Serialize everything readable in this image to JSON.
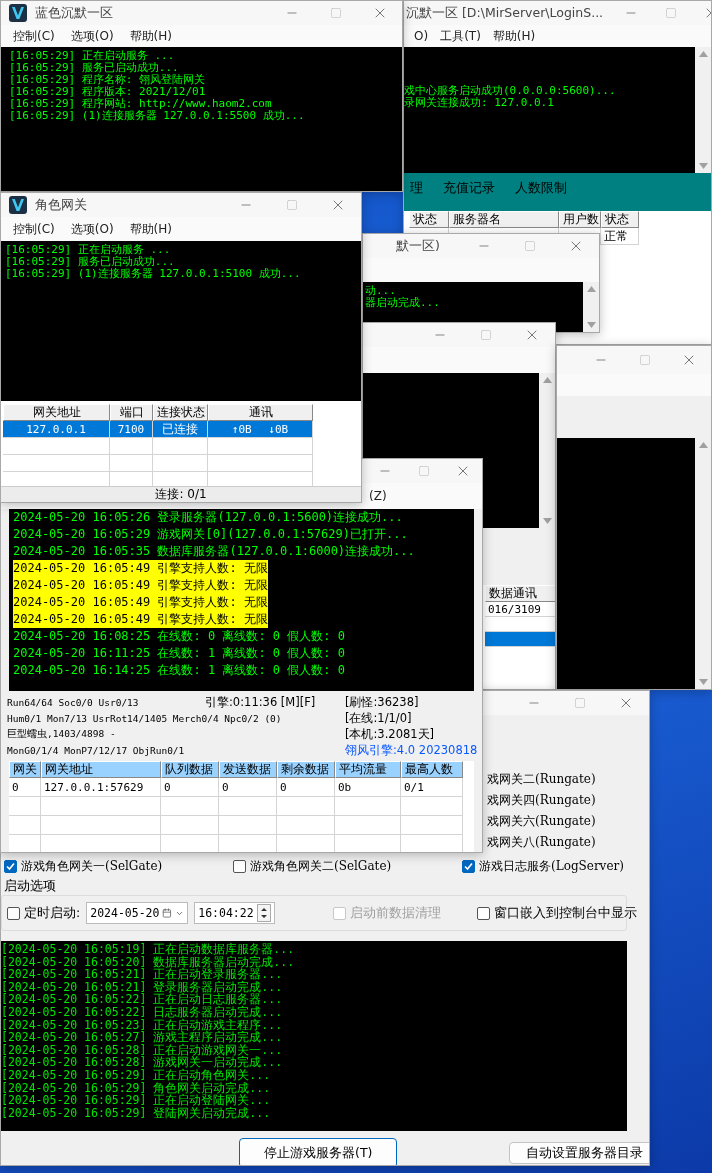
{
  "login_server_window": {
    "title": "沉默一区  [D:\\MirServer\\LoginS...",
    "menu": [
      "O)",
      "工具(T)",
      "帮助(H)"
    ],
    "log": [
      "戏中心服务启动成功(0.0.0.0:5600)...",
      "录网关连接成功: 127.0.0.1"
    ],
    "tabs": [
      "理",
      "充值记录",
      "人数限制"
    ],
    "columns": [
      "状态",
      "服务器名",
      "用户数",
      "状态"
    ],
    "row_status": "正常"
  },
  "launcher_window": {
    "title": "蓝色沉默一区",
    "menu": [
      "控制(C)",
      "选项(O)",
      "帮助(H)"
    ],
    "log": [
      "[16:05:29] 正在启动服务 ...",
      "[16:05:29] 服务已启动成功...",
      "[16:05:29] 程序名称: 翎风登陆网关",
      "[16:05:29] 程序版本: 2021/12/01",
      "[16:05:29] 程序网站: http://www.haom2.com",
      "[16:05:29] (1)连接服务器 127.0.0.1:5500 成功..."
    ]
  },
  "log_window": {
    "title": "默一区)",
    "log": [
      "动...",
      "器启动完成..."
    ]
  },
  "data_window": {
    "column_heading": "数据通讯",
    "rows": [
      {
        "text": "016/3109",
        "selected": false
      },
      {
        "selected": true
      }
    ]
  },
  "control_window": {
    "gates": [
      "戏网关二(Rungate)",
      "戏网关四(Rungate)",
      "戏网关六(Rungate)",
      "戏网关八(Rungate)"
    ],
    "services": [
      {
        "label": "游戏角色网关一(SelGate)",
        "checked": true
      },
      {
        "label": "游戏角色网关二(SelGate)",
        "checked": false
      },
      {
        "label": "游戏日志服务(LogServer)",
        "checked": true
      }
    ],
    "startup_options": {
      "title": "启动选项",
      "timed_start": {
        "label": "定时启动:",
        "checked": false
      },
      "date": "2024-05-20",
      "time": "16:04:22",
      "clean_data": {
        "label": "启动前数据清理",
        "checked": false,
        "disabled": true
      },
      "embed": {
        "label": "窗口嵌入到控制台中显示",
        "checked": false
      }
    },
    "log": [
      "[2024-05-20 16:05:19] 正在启动数据库服务器...",
      "[2024-05-20 16:05:20] 数据库服务器启动完成...",
      "[2024-05-20 16:05:21] 正在启动登录服务器...",
      "[2024-05-20 16:05:21] 登录服务器启动完成...",
      "[2024-05-20 16:05:22] 正在启动日志服务器...",
      "[2024-05-20 16:05:22] 日志服务器启动完成...",
      "[2024-05-20 16:05:23] 正在启动游戏主程序...",
      "[2024-05-20 16:05:27] 游戏主程序启动完成...",
      "[2024-05-20 16:05:28] 正在启动游戏网关一...",
      "[2024-05-20 16:05:28] 游戏网关一启动完成...",
      "[2024-05-20 16:05:29] 正在启动角色网关...",
      "[2024-05-20 16:05:29] 角色网关启动完成...",
      "[2024-05-20 16:05:29] 正在启动登陆网关...",
      "[2024-05-20 16:05:29] 登陆网关启动完成..."
    ],
    "buttons": [
      {
        "label": "停止游戏服务器(T)",
        "focused": true
      },
      {
        "label": "自动设置服务器目录",
        "focused": false
      }
    ]
  },
  "engine_window": {
    "menu": [
      "(Z)"
    ],
    "log": [
      {
        "text": "2024-05-20 16:05:26 登录服务器(127.0.0.1:5600)连接成功...",
        "highlighted": false
      },
      {
        "text": "2024-05-20 16:05:29 游戏网关[0](127.0.0.1:57629)已打开...",
        "highlighted": false
      },
      {
        "text": "2024-05-20 16:05:35 数据库服务器(127.0.0.1:6000)连接成功...",
        "highlighted": false
      },
      {
        "text": "2024-05-20 16:05:49 引擎支持人数: 无限",
        "highlighted": true
      },
      {
        "text": "2024-05-20 16:05:49 引擎支持人数: 无限",
        "highlighted": true
      },
      {
        "text": "2024-05-20 16:05:49 引擎支持人数: 无限",
        "highlighted": true
      },
      {
        "text": "2024-05-20 16:05:49 引擎支持人数: 无限",
        "highlighted": true
      },
      {
        "text": "2024-05-20 16:08:25 在线数: 0 离线数: 0 假人数: 0",
        "highlighted": false
      },
      {
        "text": "2024-05-20 16:11:25 在线数: 1 离线数: 0 假人数: 0",
        "highlighted": false
      },
      {
        "text": "2024-05-20 16:14:25 在线数: 1 离线数: 0 假人数: 0",
        "highlighted": false
      }
    ],
    "stats": [
      {
        "text": "Run64/64 Soc0/0 Usr0/13",
        "engine": "引擎:0:11:36 [M][F]",
        "info": "[刷怪:36238]"
      },
      {
        "text": "Hum0/1 Mon7/13 UsrRot14/1405 Merch0/4 Npc0/2 (0)",
        "info": "[在线:1/1/0]"
      },
      {
        "text": "巨型蠕虫,1403/4898 -",
        "info": "[本机:3.2081天]"
      },
      {
        "text": "MonG0/1/4 MonP7/12/17 ObjRun0/1",
        "version": "翎风引擎:4.0 20230818"
      }
    ],
    "columns": [
      "网关",
      "网关地址",
      "队列数据",
      "发送数据",
      "剩余数据",
      "平均流量",
      "最高人数"
    ],
    "rows": [
      {
        "cells": [
          "0",
          "127.0.0.1:57629",
          "0",
          "0",
          "0",
          "0b",
          "0/1"
        ]
      }
    ]
  },
  "role_gateway_window": {
    "title": "角色网关",
    "menu": [
      "控制(C)",
      "选项(O)",
      "帮助(H)"
    ],
    "log": [
      "[16:05:29] 正在启动服务 ...",
      "[16:05:29] 服务已启动成功...",
      "[16:05:29] (1)连接服务器 127.0.0.1:5100 成功..."
    ],
    "columns": [
      "网关地址",
      "端口",
      "连接状态",
      "通讯"
    ],
    "rows": [
      {
        "cells": [
          "127.0.0.1",
          "7100",
          "已连接",
          "↑0B ↓0B"
        ],
        "selected": true
      }
    ],
    "status": "连接: 0/1"
  }
}
